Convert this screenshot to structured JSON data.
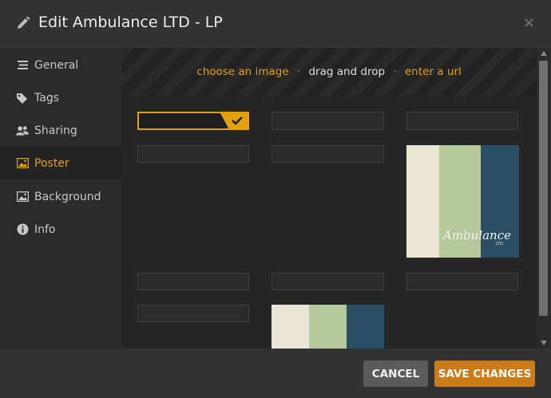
{
  "dialog": {
    "title": "Edit Ambulance LTD - LP",
    "close_label": "×"
  },
  "sidebar": {
    "items": [
      {
        "label": "General",
        "icon": "list-icon"
      },
      {
        "label": "Tags",
        "icon": "tag-icon"
      },
      {
        "label": "Sharing",
        "icon": "users-icon"
      },
      {
        "label": "Poster",
        "icon": "image-icon",
        "active": true
      },
      {
        "label": "Background",
        "icon": "image-icon"
      },
      {
        "label": "Info",
        "icon": "info-icon"
      }
    ]
  },
  "upload": {
    "choose": "choose an image",
    "sep": "·",
    "drag": "drag and drop",
    "url": "enter a url"
  },
  "poster_art": {
    "script_text": "Ambulance",
    "ltd_text": "LTD"
  },
  "footer": {
    "cancel_label": "CANCEL",
    "save_label": "SAVE CHANGES"
  },
  "colors": {
    "accent": "#e5a00d",
    "save_button": "#cc7b19",
    "cancel_button": "#5b5b5b"
  }
}
